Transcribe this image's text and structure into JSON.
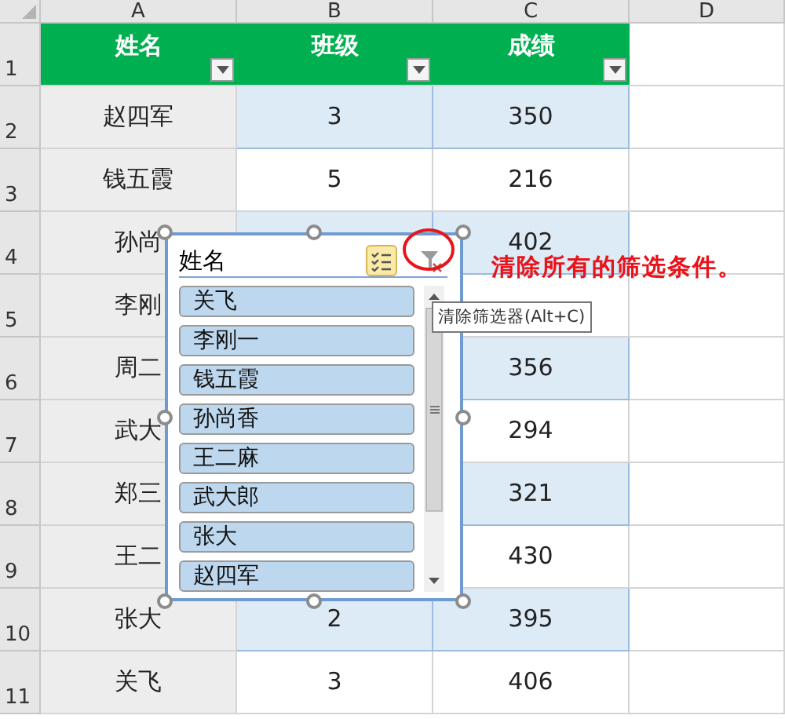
{
  "columns": [
    "A",
    "B",
    "C",
    "D"
  ],
  "header_row": {
    "number": "1",
    "cells": [
      "姓名",
      "班级",
      "成绩"
    ]
  },
  "rows": [
    {
      "number": "2",
      "banded": true,
      "cells": [
        "赵四军",
        "3",
        "350"
      ]
    },
    {
      "number": "3",
      "banded": false,
      "cells": [
        "钱五霞",
        "5",
        "216"
      ]
    },
    {
      "number": "4",
      "banded": true,
      "cells": [
        "孙尚",
        null,
        "402"
      ]
    },
    {
      "number": "5",
      "banded": false,
      "cells": [
        "李刚",
        null,
        null
      ]
    },
    {
      "number": "6",
      "banded": true,
      "cells": [
        "周二",
        null,
        "356"
      ]
    },
    {
      "number": "7",
      "banded": false,
      "cells": [
        "武大",
        null,
        "294"
      ]
    },
    {
      "number": "8",
      "banded": true,
      "cells": [
        "郑三",
        null,
        "321"
      ]
    },
    {
      "number": "9",
      "banded": false,
      "cells": [
        "王二",
        null,
        "430"
      ]
    },
    {
      "number": "10",
      "banded": true,
      "cells": [
        "张大",
        "2",
        "395"
      ]
    },
    {
      "number": "11",
      "banded": false,
      "cells": [
        "关飞",
        "3",
        "406"
      ]
    }
  ],
  "slicer": {
    "title": "姓名",
    "items": [
      {
        "label": "关飞",
        "selected": true
      },
      {
        "label": "李刚一",
        "selected": true
      },
      {
        "label": "钱五霞",
        "selected": true
      },
      {
        "label": "孙尚香",
        "selected": true
      },
      {
        "label": "王二麻",
        "selected": true
      },
      {
        "label": "武大郎",
        "selected": true
      },
      {
        "label": "张大",
        "selected": true
      },
      {
        "label": "赵四军",
        "selected": true
      }
    ]
  },
  "tooltip": "清除筛选器(Alt+C)",
  "annotation": "清除所有的筛选条件。"
}
